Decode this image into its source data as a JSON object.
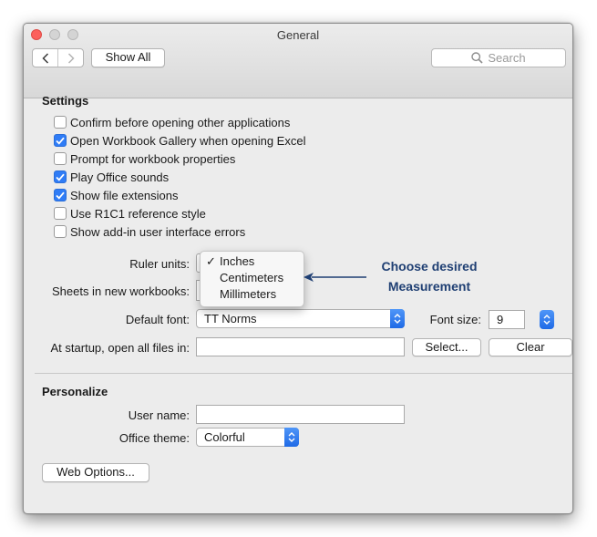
{
  "window": {
    "title": "General"
  },
  "toolbar": {
    "back_icon": "chevron-left-icon",
    "forward_icon": "chevron-right-icon",
    "show_all_label": "Show All",
    "search_placeholder": "Search"
  },
  "settings": {
    "heading": "Settings",
    "options": [
      {
        "label": "Confirm before opening other applications",
        "checked": false
      },
      {
        "label": "Open Workbook Gallery when opening Excel",
        "checked": true
      },
      {
        "label": "Prompt for workbook properties",
        "checked": false
      },
      {
        "label": "Play Office sounds",
        "checked": true
      },
      {
        "label": "Show file extensions",
        "checked": true
      },
      {
        "label": "Use R1C1 reference style",
        "checked": false
      },
      {
        "label": "Show add-in user interface errors",
        "checked": false
      }
    ],
    "ruler_units_label": "Ruler units:",
    "ruler_units_options": [
      "Inches",
      "Centimeters",
      "Millimeters"
    ],
    "ruler_units_selected": "Inches",
    "sheets_label": "Sheets in new workbooks:",
    "default_font_label": "Default font:",
    "default_font_value": "TT Norms",
    "font_size_label": "Font size:",
    "font_size_value": "9",
    "startup_label": "At startup, open all files in:",
    "startup_value": "",
    "select_button": "Select...",
    "clear_button": "Clear"
  },
  "personalize": {
    "heading": "Personalize",
    "user_name_label": "User name:",
    "user_name_value": "",
    "office_theme_label": "Office theme:",
    "office_theme_value": "Colorful",
    "web_options_button": "Web Options..."
  },
  "annotation": {
    "line1": "Choose desired",
    "line2": "Measurement",
    "color": "#1f3f73"
  },
  "colors": {
    "accent": "#2f7cf6",
    "close": "#fc605c"
  }
}
